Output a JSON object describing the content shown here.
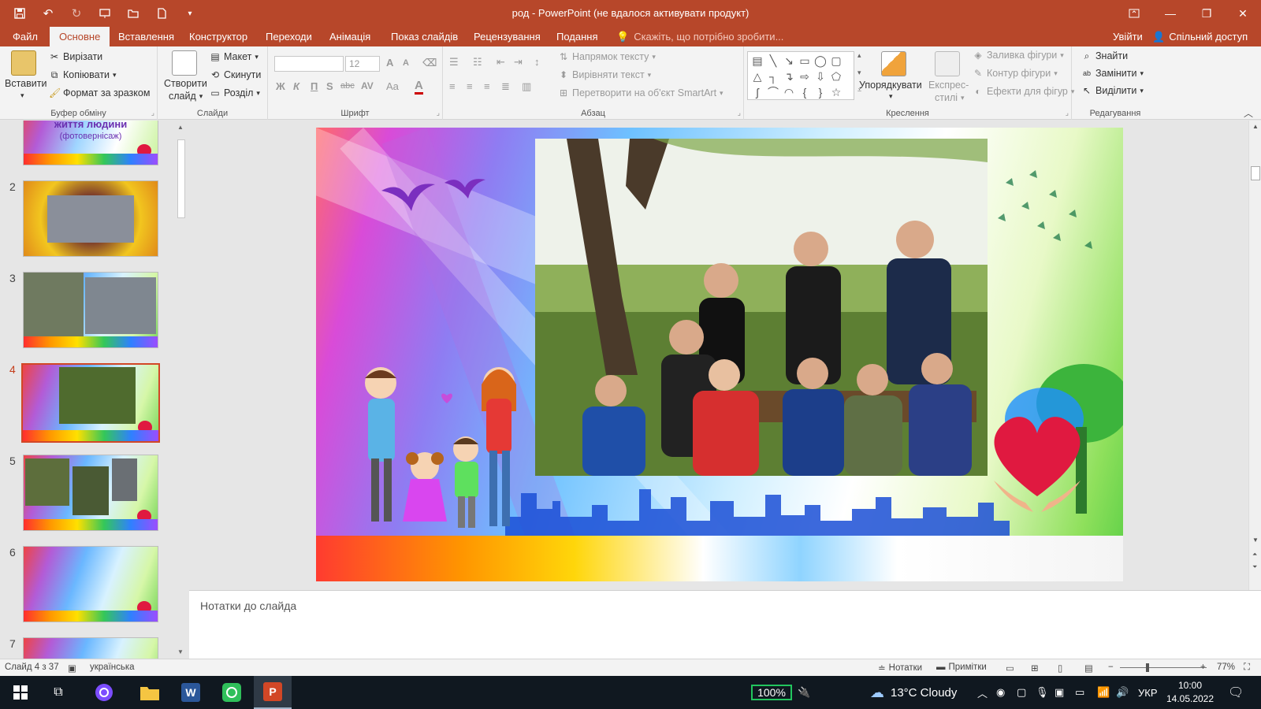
{
  "window": {
    "title": "род - PowerPoint (не вдалося активувати продукт)"
  },
  "tabs": [
    {
      "label": "Файл"
    },
    {
      "label": "Основне",
      "active": true
    },
    {
      "label": "Вставлення"
    },
    {
      "label": "Конструктор"
    },
    {
      "label": "Переходи"
    },
    {
      "label": "Анімація"
    },
    {
      "label": "Показ слайдів"
    },
    {
      "label": "Рецензування"
    },
    {
      "label": "Подання"
    }
  ],
  "tell_me": "Скажіть, що потрібно зробити...",
  "sign_in": "Увійти",
  "share": "Спільний доступ",
  "ribbon": {
    "clipboard": {
      "paste": "Вставити",
      "cut": "Вирізати",
      "copy": "Копіювати",
      "format_painter": "Формат за зразком",
      "label": "Буфер обміну"
    },
    "slides": {
      "new_slide_line1": "Створити",
      "new_slide_line2": "слайд",
      "layout": "Макет",
      "reset": "Скинути",
      "section": "Розділ",
      "label": "Слайди"
    },
    "font": {
      "size": "12",
      "bold": "Ж",
      "italic": "К",
      "underline": "П",
      "shadow": "S",
      "strike": "abc",
      "spacing": "AV",
      "case": "Aa",
      "color": "A",
      "grow": "A",
      "shrink": "A",
      "label": "Шрифт"
    },
    "paragraph": {
      "text_direction": "Напрямок тексту",
      "align_text": "Вирівняти текст",
      "smartart": "Перетворити на об'єкт SmartArt",
      "label": "Абзац"
    },
    "drawing": {
      "arrange": "Упорядкувати",
      "quick_styles_line1": "Експрес-",
      "quick_styles_line2": "стилі",
      "shape_fill": "Заливка фігури",
      "shape_outline": "Контур фігури",
      "shape_effects": "Ефекти для фігур",
      "label": "Креслення"
    },
    "editing": {
      "find": "Знайти",
      "replace": "Замінити",
      "select": "Виділити",
      "label": "Редагування"
    }
  },
  "thumbnails": [
    {
      "num": "",
      "caption_line1": "життя людини",
      "caption_line2": "(фотовернісаж)"
    },
    {
      "num": "2"
    },
    {
      "num": "3"
    },
    {
      "num": "4",
      "active": true
    },
    {
      "num": "5"
    },
    {
      "num": "6"
    },
    {
      "num": "7"
    }
  ],
  "notes_placeholder": "Нотатки до слайда",
  "status": {
    "slide_info": "Слайд 4 з 37",
    "language": "українська",
    "notes": "Нотатки",
    "comments": "Примітки",
    "zoom": "77%"
  },
  "taskbar": {
    "battery": "100%",
    "weather": "13°C  Cloudy",
    "language": "УКР",
    "time": "10:00",
    "date": "14.05.2022"
  },
  "colors": {
    "accent": "#b7472a",
    "active_slide_border": "#d24726",
    "battery_green": "#22c55e"
  }
}
